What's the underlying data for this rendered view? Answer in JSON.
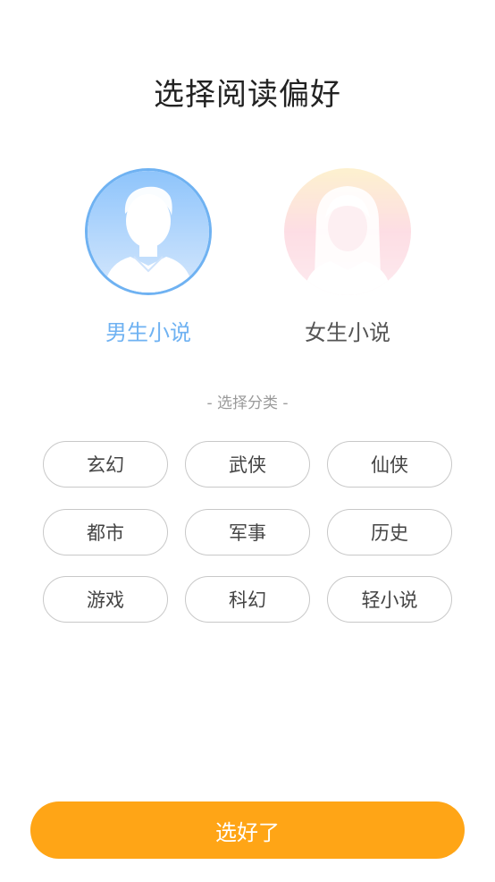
{
  "page": {
    "title": "选择阅读偏好",
    "section_label": "- 选择分类 -",
    "confirm_label": "选好了"
  },
  "genders": [
    {
      "label": "男生小说",
      "selected": true,
      "icon": "male-avatar-icon"
    },
    {
      "label": "女生小说",
      "selected": false,
      "icon": "female-avatar-icon"
    }
  ],
  "categories": [
    "玄幻",
    "武侠",
    "仙侠",
    "都市",
    "军事",
    "历史",
    "游戏",
    "科幻",
    "轻小说"
  ],
  "colors": {
    "accent_blue": "#6fb2f2",
    "button_orange": "#ffa516",
    "chip_border": "#c8c8c8",
    "female_pink": "#fbd0d8"
  }
}
